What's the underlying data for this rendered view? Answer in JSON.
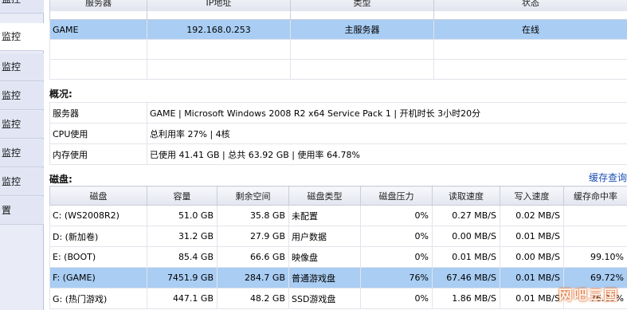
{
  "sidebar": {
    "items": [
      {
        "label": "监控"
      },
      {
        "label": "监控"
      },
      {
        "label": "监控"
      },
      {
        "label": "监控"
      },
      {
        "label": "监控"
      },
      {
        "label": "监控"
      },
      {
        "label": "监控"
      },
      {
        "label": "置"
      }
    ]
  },
  "servers": {
    "headers": [
      "服务器",
      "IP地址",
      "类型",
      "状态"
    ],
    "rows": [
      {
        "name": "GAME",
        "ip": "192.168.0.253",
        "type": "主服务器",
        "status": "在线"
      }
    ]
  },
  "overview": {
    "title": "概况:",
    "rows": [
      {
        "label": "服务器",
        "value": "GAME | Microsoft Windows 2008 R2 x64 Service Pack 1 | 开机时长 3小时20分"
      },
      {
        "label": "CPU使用",
        "value": "总利用率 27% | 4核"
      },
      {
        "label": "内存使用",
        "value": "已使用 41.41 GB | 总共 63.92 GB | 使用率 64.78%"
      }
    ]
  },
  "disks": {
    "title": "磁盘:",
    "cache_link": "缓存查询",
    "headers": [
      "磁盘",
      "容量",
      "剩余空间",
      "磁盘类型",
      "磁盘压力",
      "读取速度",
      "写入速度",
      "缓存命中率"
    ],
    "rows": [
      {
        "disk": "C: (WS2008R2)",
        "capacity": "51.0  GB",
        "free": "35.8  GB",
        "type": "未配置",
        "pressure": "0%",
        "read": "0.27  MB/S",
        "write": "0.02  MB/S",
        "hit": ""
      },
      {
        "disk": "D: (新加卷)",
        "capacity": "31.2  GB",
        "free": "27.9  GB",
        "type": "用户数据",
        "pressure": "0%",
        "read": "0.00  MB/S",
        "write": "0.01  MB/S",
        "hit": ""
      },
      {
        "disk": "E: (BOOT)",
        "capacity": "85.4  GB",
        "free": "66.6  GB",
        "type": "映像盘",
        "pressure": "0%",
        "read": "0.01  MB/S",
        "write": "0.00  MB/S",
        "hit": "99.10%"
      },
      {
        "disk": "F: (GAME)",
        "capacity": "7451.9  GB",
        "free": "284.7  GB",
        "type": "普通游戏盘",
        "pressure": "76%",
        "read": "67.46  MB/S",
        "write": "0.01  MB/S",
        "hit": "69.72%"
      },
      {
        "disk": "G: (热门游戏)",
        "capacity": "447.1  GB",
        "free": "48.2  GB",
        "type": "SSD游戏盘",
        "pressure": "0%",
        "read": "1.86  MB/S",
        "write": "0.01  MB/S",
        "hit": "76.29%"
      }
    ]
  },
  "watermark": "网吧三国",
  "colors": {
    "selected_row": "#a9cdf3",
    "sidebar_bg": "#e2e6f4",
    "link": "#1c4fb5"
  }
}
